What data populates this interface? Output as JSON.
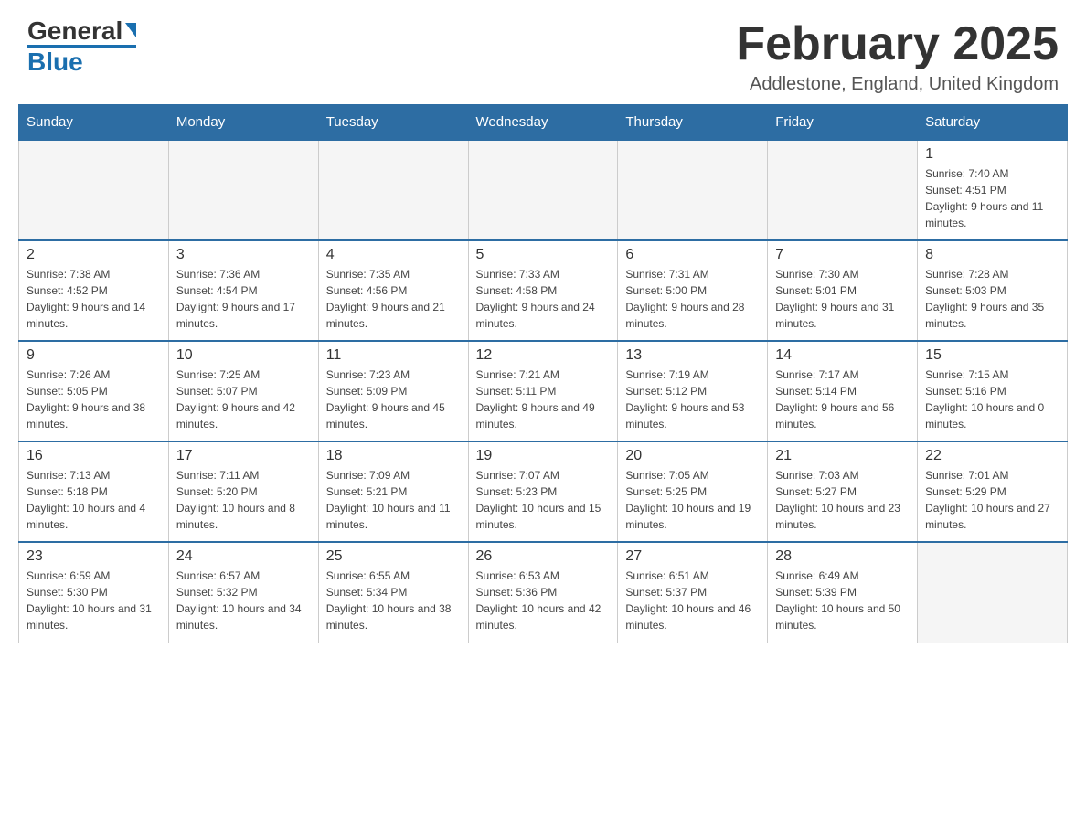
{
  "header": {
    "logo": {
      "text_general": "General",
      "text_blue": "Blue"
    },
    "title": "February 2025",
    "location": "Addlestone, England, United Kingdom"
  },
  "weekdays": [
    "Sunday",
    "Monday",
    "Tuesday",
    "Wednesday",
    "Thursday",
    "Friday",
    "Saturday"
  ],
  "weeks": [
    [
      {
        "day": "",
        "info": ""
      },
      {
        "day": "",
        "info": ""
      },
      {
        "day": "",
        "info": ""
      },
      {
        "day": "",
        "info": ""
      },
      {
        "day": "",
        "info": ""
      },
      {
        "day": "",
        "info": ""
      },
      {
        "day": "1",
        "info": "Sunrise: 7:40 AM\nSunset: 4:51 PM\nDaylight: 9 hours and 11 minutes."
      }
    ],
    [
      {
        "day": "2",
        "info": "Sunrise: 7:38 AM\nSunset: 4:52 PM\nDaylight: 9 hours and 14 minutes."
      },
      {
        "day": "3",
        "info": "Sunrise: 7:36 AM\nSunset: 4:54 PM\nDaylight: 9 hours and 17 minutes."
      },
      {
        "day": "4",
        "info": "Sunrise: 7:35 AM\nSunset: 4:56 PM\nDaylight: 9 hours and 21 minutes."
      },
      {
        "day": "5",
        "info": "Sunrise: 7:33 AM\nSunset: 4:58 PM\nDaylight: 9 hours and 24 minutes."
      },
      {
        "day": "6",
        "info": "Sunrise: 7:31 AM\nSunset: 5:00 PM\nDaylight: 9 hours and 28 minutes."
      },
      {
        "day": "7",
        "info": "Sunrise: 7:30 AM\nSunset: 5:01 PM\nDaylight: 9 hours and 31 minutes."
      },
      {
        "day": "8",
        "info": "Sunrise: 7:28 AM\nSunset: 5:03 PM\nDaylight: 9 hours and 35 minutes."
      }
    ],
    [
      {
        "day": "9",
        "info": "Sunrise: 7:26 AM\nSunset: 5:05 PM\nDaylight: 9 hours and 38 minutes."
      },
      {
        "day": "10",
        "info": "Sunrise: 7:25 AM\nSunset: 5:07 PM\nDaylight: 9 hours and 42 minutes."
      },
      {
        "day": "11",
        "info": "Sunrise: 7:23 AM\nSunset: 5:09 PM\nDaylight: 9 hours and 45 minutes."
      },
      {
        "day": "12",
        "info": "Sunrise: 7:21 AM\nSunset: 5:11 PM\nDaylight: 9 hours and 49 minutes."
      },
      {
        "day": "13",
        "info": "Sunrise: 7:19 AM\nSunset: 5:12 PM\nDaylight: 9 hours and 53 minutes."
      },
      {
        "day": "14",
        "info": "Sunrise: 7:17 AM\nSunset: 5:14 PM\nDaylight: 9 hours and 56 minutes."
      },
      {
        "day": "15",
        "info": "Sunrise: 7:15 AM\nSunset: 5:16 PM\nDaylight: 10 hours and 0 minutes."
      }
    ],
    [
      {
        "day": "16",
        "info": "Sunrise: 7:13 AM\nSunset: 5:18 PM\nDaylight: 10 hours and 4 minutes."
      },
      {
        "day": "17",
        "info": "Sunrise: 7:11 AM\nSunset: 5:20 PM\nDaylight: 10 hours and 8 minutes."
      },
      {
        "day": "18",
        "info": "Sunrise: 7:09 AM\nSunset: 5:21 PM\nDaylight: 10 hours and 11 minutes."
      },
      {
        "day": "19",
        "info": "Sunrise: 7:07 AM\nSunset: 5:23 PM\nDaylight: 10 hours and 15 minutes."
      },
      {
        "day": "20",
        "info": "Sunrise: 7:05 AM\nSunset: 5:25 PM\nDaylight: 10 hours and 19 minutes."
      },
      {
        "day": "21",
        "info": "Sunrise: 7:03 AM\nSunset: 5:27 PM\nDaylight: 10 hours and 23 minutes."
      },
      {
        "day": "22",
        "info": "Sunrise: 7:01 AM\nSunset: 5:29 PM\nDaylight: 10 hours and 27 minutes."
      }
    ],
    [
      {
        "day": "23",
        "info": "Sunrise: 6:59 AM\nSunset: 5:30 PM\nDaylight: 10 hours and 31 minutes."
      },
      {
        "day": "24",
        "info": "Sunrise: 6:57 AM\nSunset: 5:32 PM\nDaylight: 10 hours and 34 minutes."
      },
      {
        "day": "25",
        "info": "Sunrise: 6:55 AM\nSunset: 5:34 PM\nDaylight: 10 hours and 38 minutes."
      },
      {
        "day": "26",
        "info": "Sunrise: 6:53 AM\nSunset: 5:36 PM\nDaylight: 10 hours and 42 minutes."
      },
      {
        "day": "27",
        "info": "Sunrise: 6:51 AM\nSunset: 5:37 PM\nDaylight: 10 hours and 46 minutes."
      },
      {
        "day": "28",
        "info": "Sunrise: 6:49 AM\nSunset: 5:39 PM\nDaylight: 10 hours and 50 minutes."
      },
      {
        "day": "",
        "info": ""
      }
    ]
  ]
}
